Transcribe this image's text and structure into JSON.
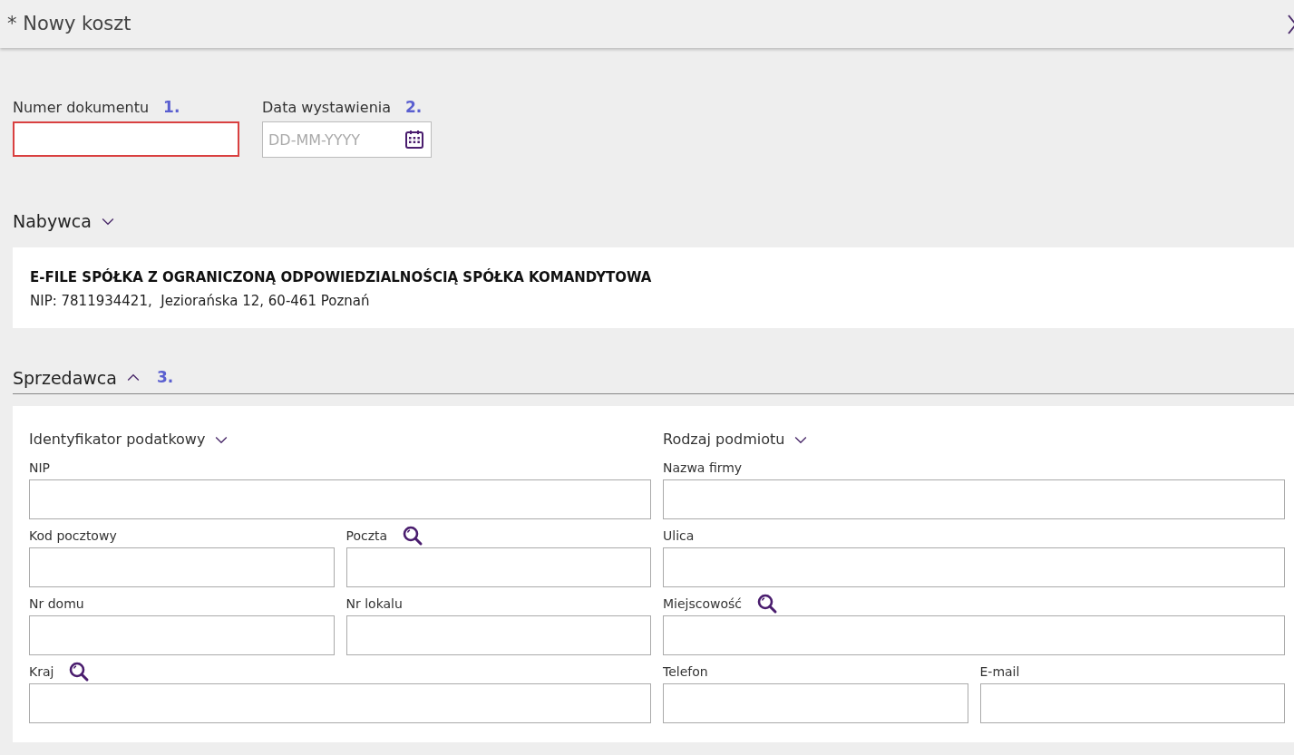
{
  "window": {
    "title": "* Nowy koszt"
  },
  "top_fields": [
    {
      "label": "Numer dokumentu",
      "marker": "1.",
      "invalid": true,
      "kind": "text"
    },
    {
      "label": "Data wystawienia",
      "marker": "2.",
      "invalid": false,
      "kind": "date",
      "placeholder": "DD-MM-YYYY"
    }
  ],
  "buyer": {
    "title": "Nabywca",
    "expanded": false,
    "name": "E-FILE SPÓŁKA Z OGRANICZONĄ ODPOWIEDZIALNOŚCIĄ SPÓŁKA KOMANDYTOWA",
    "details": "NIP: 7811934421,  Jeziorańska 12, 60-461 Poznań"
  },
  "seller": {
    "title": "Sprzedawca",
    "expanded": true,
    "marker": "3.",
    "columns": [
      {
        "title": "Identyfikator podatkowy",
        "expanded": false,
        "rows": [
          [
            {
              "label": "NIP",
              "lookup": false
            }
          ],
          [
            {
              "label": "Kod pocztowy",
              "lookup": false
            },
            {
              "label": "Poczta",
              "lookup": true
            }
          ],
          [
            {
              "label": "Nr domu",
              "lookup": false
            },
            {
              "label": "Nr lokalu",
              "lookup": false
            }
          ],
          [
            {
              "label": "Kraj",
              "lookup": true
            }
          ]
        ]
      },
      {
        "title": "Rodzaj podmiotu",
        "expanded": false,
        "rows": [
          [
            {
              "label": "Nazwa firmy",
              "lookup": false
            }
          ],
          [
            {
              "label": "Ulica",
              "lookup": false
            }
          ],
          [
            {
              "label": "Miejscowość",
              "lookup": true
            }
          ],
          [
            {
              "label": "Telefon",
              "lookup": false
            },
            {
              "label": "E-mail",
              "lookup": false
            }
          ]
        ]
      }
    ]
  }
}
